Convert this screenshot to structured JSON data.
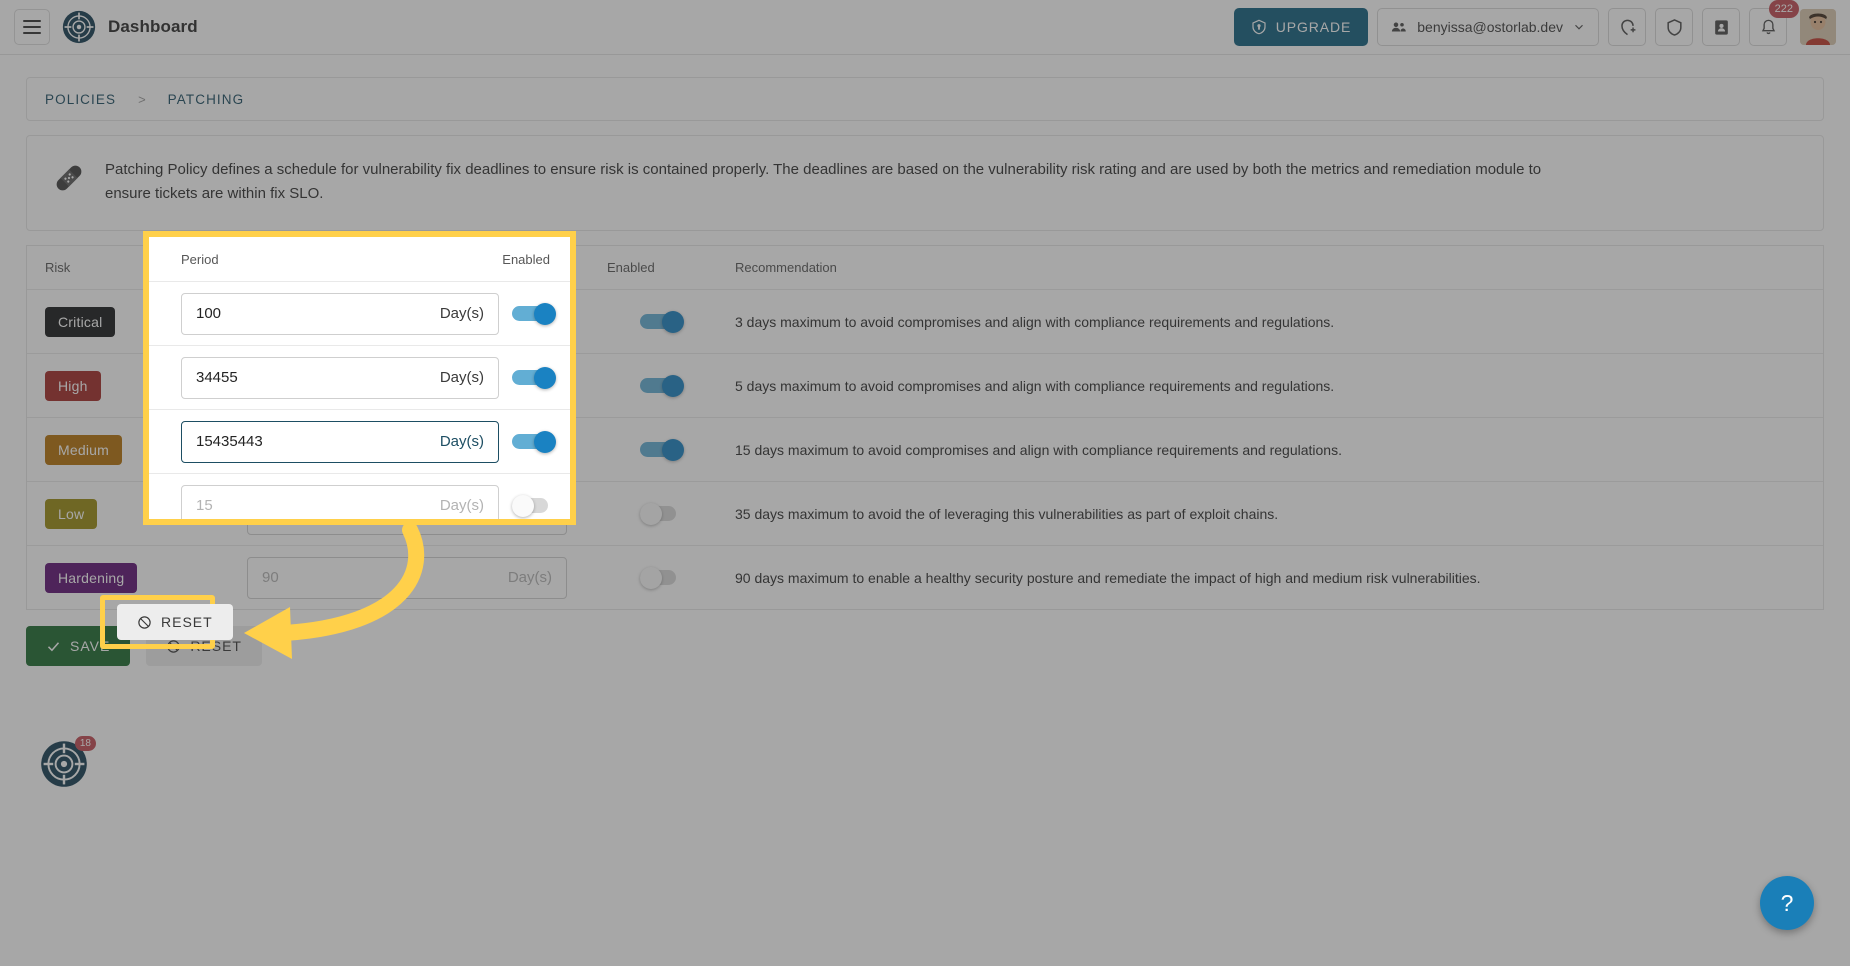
{
  "topbar": {
    "menu_icon": "hamburger-icon",
    "logo_icon": "ostorlab-logo-icon",
    "title": "Dashboard",
    "upgrade_label": "UPGRADE",
    "upgrade_icon": "shield-upgrade-icon",
    "org_value": "benyissa@ostorlab.dev",
    "org_icon": "group-icon",
    "org_chevron": "chevron-down-icon",
    "scan_icon": "add-scan-icon",
    "shield_icon": "shield-icon",
    "contacts_icon": "contact-card-icon",
    "bell_icon": "bell-icon",
    "notification_count": "222",
    "avatar_name": "user-avatar"
  },
  "breadcrumb": {
    "parent": "POLICIES",
    "separator": ">",
    "current": "PATCHING"
  },
  "description": {
    "icon": "patch-bandage-icon",
    "text": "Patching Policy defines a schedule for vulnerability fix deadlines to ensure risk is contained properly. The deadlines are based on the vulnerability risk rating and are used by both the metrics and remediation module to ensure tickets are within fix SLO."
  },
  "table": {
    "headers": {
      "risk": "Risk",
      "period": "Period",
      "enabled": "Enabled",
      "recommendation": "Recommendation"
    },
    "rows": [
      {
        "risk": "Critical",
        "risk_color": "#17181a",
        "risk_text_color": "#ffffff",
        "value": "100",
        "placeholder": "",
        "unit": "Day(s)",
        "enabled": true,
        "focused": false,
        "recommendation": "3 days maximum to avoid compromises and align with compliance requirements and regulations."
      },
      {
        "risk": "High",
        "risk_color": "#a32b27",
        "risk_text_color": "#ffffff",
        "value": "34455",
        "placeholder": "",
        "unit": "Day(s)",
        "enabled": true,
        "focused": false,
        "recommendation": "5 days maximum to avoid compromises and align with compliance requirements and regulations."
      },
      {
        "risk": "Medium",
        "risk_color": "#b5720a",
        "risk_text_color": "#ffffff",
        "value": "15435443",
        "placeholder": "",
        "unit": "Day(s)",
        "enabled": true,
        "focused": true,
        "recommendation": "15 days maximum to avoid compromises and align with compliance requirements and regulations."
      },
      {
        "risk": "Low",
        "risk_color": "#9a8b12",
        "risk_text_color": "#ffffff",
        "value": "",
        "placeholder": "15",
        "unit": "Day(s)",
        "enabled": false,
        "focused": false,
        "recommendation": "35 days maximum to avoid the of leveraging this vulnerabilities as part of exploit chains."
      },
      {
        "risk": "Hardening",
        "risk_color": "#5d1273",
        "risk_text_color": "#ffffff",
        "value": "",
        "placeholder": "90",
        "unit": "Day(s)",
        "enabled": false,
        "focused": false,
        "recommendation": "90 days maximum to enable a healthy security posture and remediate the impact of high and medium risk vulnerabilities."
      }
    ]
  },
  "actions": {
    "save_label": "SAVE",
    "save_icon": "check-icon",
    "reset_label": "RESET",
    "reset_icon": "ban-circle-icon"
  },
  "footer": {
    "logo_icon": "ostorlab-logo-icon",
    "logo_badge": "18",
    "help_label": "?"
  },
  "highlight": {
    "color": "#ffd04a",
    "arrow_name": "curved-arrow-pointing-to-reset"
  }
}
